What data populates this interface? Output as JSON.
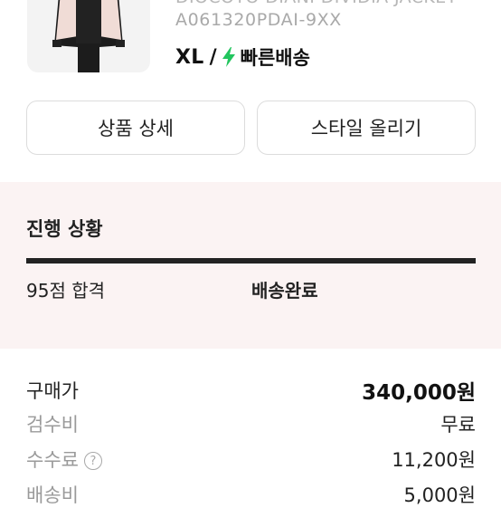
{
  "product": {
    "partial_name": "DIOCOTO DIANI DIVIDIA JACKET",
    "model_code": "A061320PDAI-9XX",
    "size": "XL",
    "separator": "/",
    "bolt_icon": "lightning-bolt-icon",
    "bolt_color": "#22c55e",
    "delivery": "빠른배송"
  },
  "actions": {
    "detail_label": "상품 상세",
    "style_label": "스타일 올리기"
  },
  "status": {
    "title": "진행 상황",
    "score": "95점 합격",
    "stage": "배송완료",
    "progress": 1.0
  },
  "price": {
    "rows": [
      {
        "label": "구매가",
        "value": "340,000원"
      },
      {
        "label": "검수비",
        "value": "무료"
      },
      {
        "label": "수수료",
        "value": "11,200원",
        "help_icon": "question-circle-icon"
      },
      {
        "label": "배송비",
        "value": "5,000원"
      }
    ]
  }
}
